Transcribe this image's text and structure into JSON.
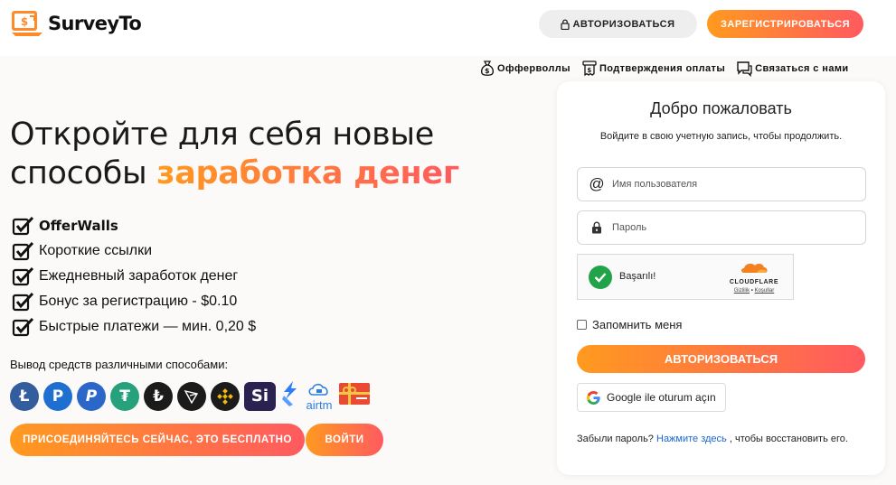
{
  "header": {
    "brand": "SurveyTo",
    "login_label": "АВТОРИЗОВАТЬСЯ",
    "register_label": "ЗАРЕГИСТРИРОВАТЬСЯ"
  },
  "subnav": {
    "items": [
      {
        "label": "Офферволлы",
        "icon": "money-bag-icon"
      },
      {
        "label": "Подтверждения оплаты",
        "icon": "receipt-icon"
      },
      {
        "label": "Связаться с нами",
        "icon": "chat-icon"
      }
    ]
  },
  "hero": {
    "line1": "Откройте для себя новые",
    "line2_plain": "способы ",
    "line2_highlight": "заработка денег"
  },
  "features": [
    "OfferWalls",
    "Короткие ссылки",
    "Ежедневный заработок денег",
    "Бонус за регистрацию - $0.10",
    "Быстрые платежи — мин. 0,20 $"
  ],
  "withdraw": {
    "label": "Вывод средств различными способами:",
    "methods": [
      "litecoin",
      "payeer",
      "paypal",
      "tether",
      "tron-lira",
      "tron",
      "binance",
      "si",
      "faucetpay",
      "airtm",
      "gift-card"
    ],
    "airtm_text": "airtm"
  },
  "cta": {
    "join_label": "ПРИСОЕДИНЯЙТЕСЬ СЕЙЧАС, ЭТО БЕСПЛАТНО",
    "enter_label": "ВОЙТИ"
  },
  "login_card": {
    "title": "Добро пожаловать",
    "subtitle": "Войдите в свою учетную запись, чтобы продолжить.",
    "username_placeholder": "Имя пользователя",
    "password_placeholder": "Пароль",
    "captcha_status": "Başarılı!",
    "captcha_brand": "CLOUDFLARE",
    "captcha_privacy": "Gizlilik",
    "captcha_sep": "•",
    "captcha_terms": "Koşullar",
    "remember_label": "Запомнить меня",
    "submit_label": "АВТОРИЗОВАТЬСЯ",
    "google_label": "Google ile oturum açın",
    "forgot_prefix": "Забыли пароль?",
    "forgot_link": "Нажмите здесь",
    "forgot_suffix": ", чтобы восстановить его."
  },
  "colors": {
    "accent_start": "#ff9a1f",
    "accent_end": "#ff5a5f",
    "captcha_green": "#22a34a",
    "link_blue": "#1a66d2"
  }
}
